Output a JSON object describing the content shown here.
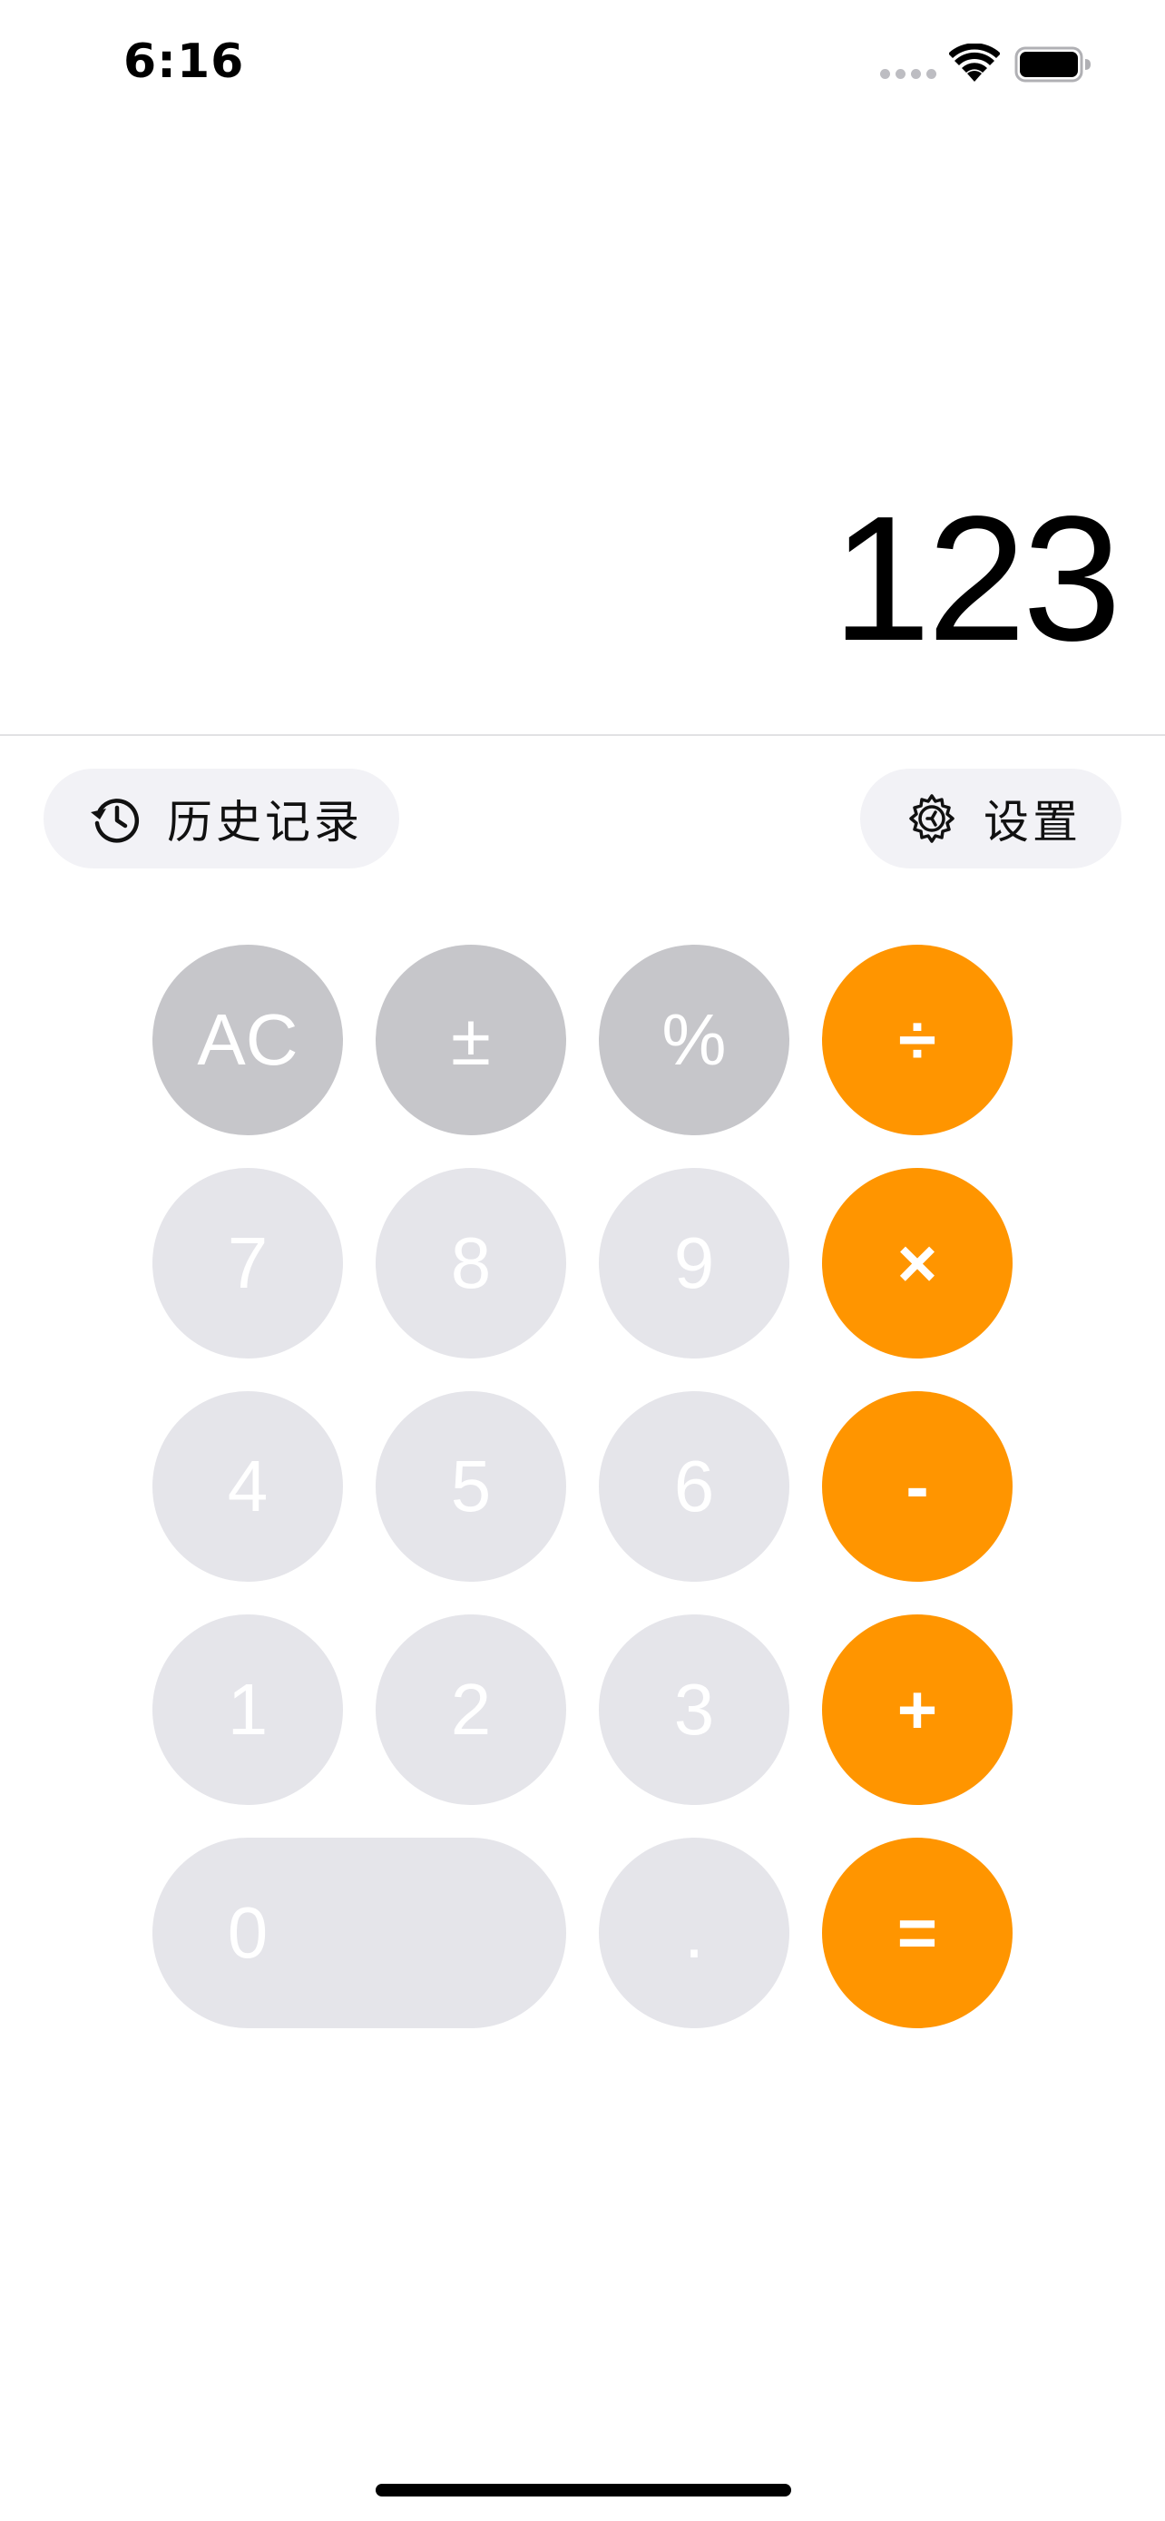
{
  "status_bar": {
    "time": "6:16"
  },
  "display": {
    "value": "123"
  },
  "toolbar": {
    "history_label": "历史记录",
    "history_icon": "clock-history-icon",
    "settings_label": "设置",
    "settings_icon": "gear-icon"
  },
  "keypad": {
    "rows": [
      [
        "AC",
        "±",
        "%",
        "÷"
      ],
      [
        "7",
        "8",
        "9",
        "×"
      ],
      [
        "4",
        "5",
        "6",
        "-"
      ],
      [
        "1",
        "2",
        "3",
        "+"
      ],
      [
        "0",
        ".",
        "="
      ]
    ]
  },
  "colors": {
    "operator": "#ff9500",
    "function_key": "#c6c6ca",
    "number_key": "#e5e5ea",
    "pill_background": "#f2f2f6"
  }
}
